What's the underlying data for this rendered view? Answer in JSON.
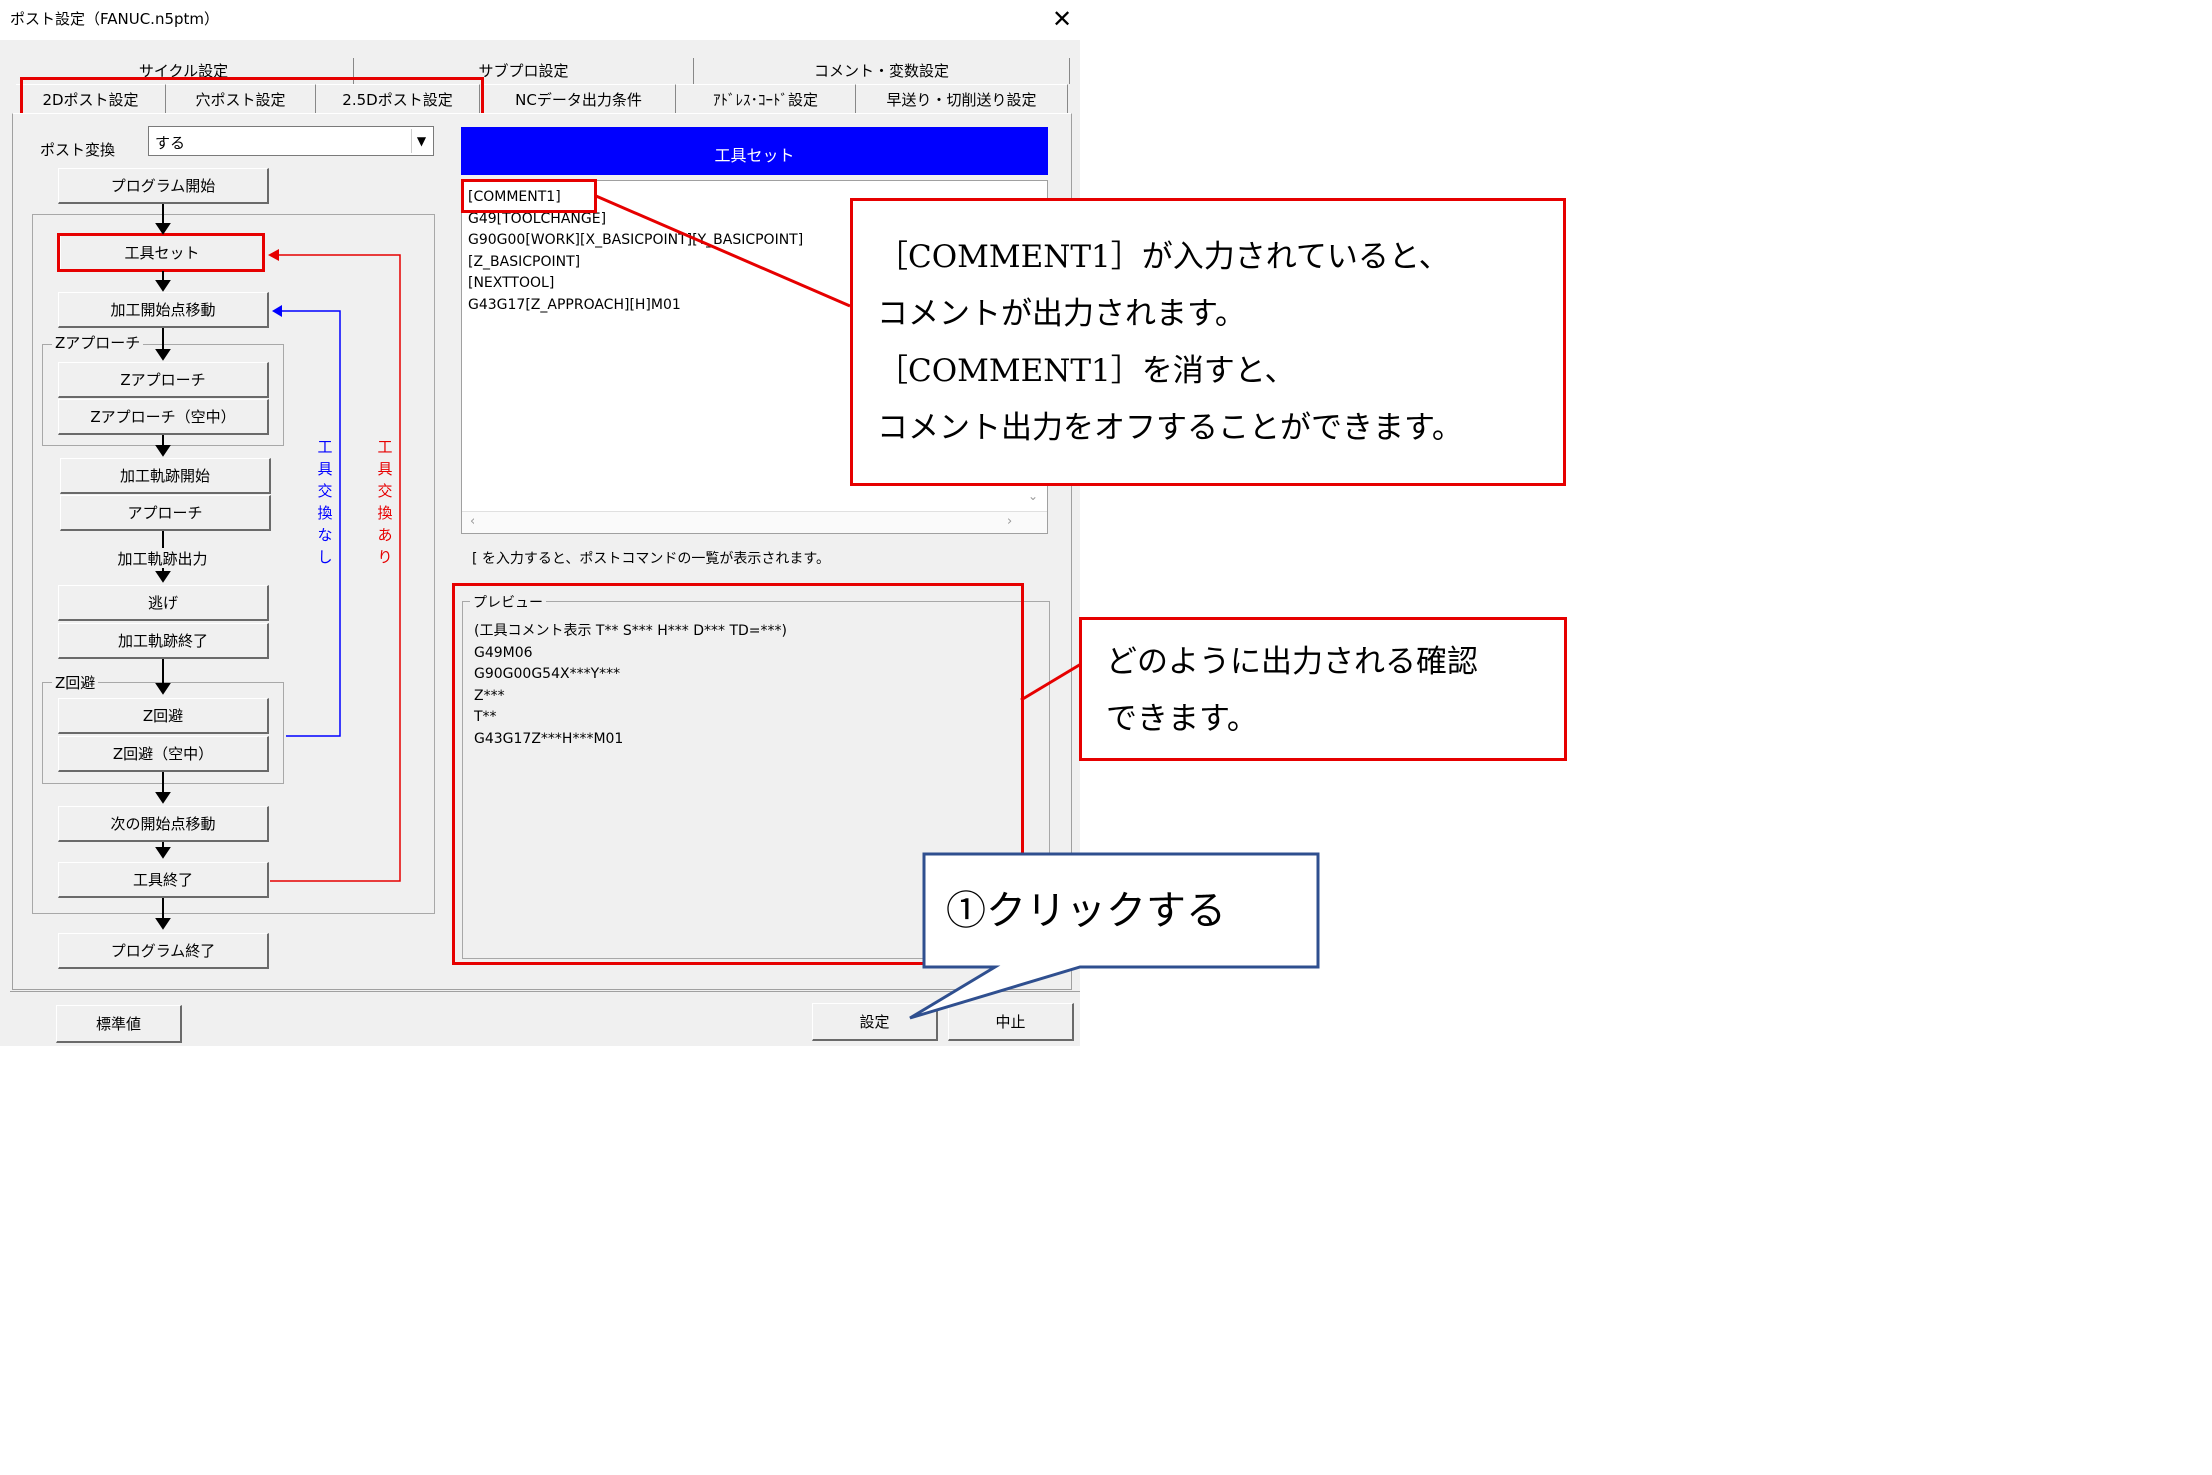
{
  "window": {
    "title": "ポスト設定（FANUC.n5ptm）",
    "close_label": "✕"
  },
  "tabs": {
    "back": [
      "サイクル設定",
      "サブプロ設定",
      "コメント・変数設定"
    ],
    "front": [
      "2Dポスト設定",
      "穴ポスト設定",
      "2.5Dポスト設定",
      "NCデータ出力条件",
      "ｱﾄﾞﾚｽ･ｺｰﾄﾞ設定",
      "早送り・切削送り設定"
    ]
  },
  "post_convert": {
    "label": "ポスト変換",
    "value": "する"
  },
  "flow": {
    "program_start": "プログラム開始",
    "tool_set": "工具セット",
    "machining_start_move": "加工開始点移動",
    "z_approach_group": "Zアプローチ",
    "z_approach": "Zアプローチ",
    "z_approach_air": "Zアプローチ（空中）",
    "path_start": "加工軌跡開始",
    "approach": "アプローチ",
    "path_output": "加工軌跡出力",
    "escape": "逃げ",
    "path_end": "加工軌跡終了",
    "z_avoid_group": "Z回避",
    "z_avoid": "Z回避",
    "z_avoid_air": "Z回避（空中）",
    "next_start_move": "次の開始点移動",
    "tool_end": "工具終了",
    "program_end": "プログラム終了",
    "no_tool_change": "工具交換なし",
    "with_tool_change": "工具交換あり"
  },
  "editor": {
    "header": "工具セット",
    "lines": [
      "[COMMENT1]",
      "G49[TOOLCHANGE]",
      "G90G00[WORK][X_BASICPOINT][Y_BASICPOINT]",
      "[Z_BASICPOINT]",
      "[NEXTTOOL]",
      "G43G17[Z_APPROACH][H]M01"
    ],
    "hint": "[ を入力すると、ポストコマンドの一覧が表示されます。"
  },
  "preview": {
    "label": "プレビュー",
    "lines": [
      "(工具コメント表示 T** S*** H*** D*** TD=***)",
      "G49M06",
      "G90G00G54X***Y***",
      "Z***",
      "T**",
      "G43G17Z***H***M01"
    ]
  },
  "buttons": {
    "default": "標準値",
    "set": "設定",
    "cancel": "中止"
  },
  "annotations": {
    "comment_note": [
      "［COMMENT1］が入力されていると、",
      "コメントが出力されます。",
      "［COMMENT1］を消すと、",
      "コメント出力をオフすることができます。"
    ],
    "preview_note": [
      "どのように出力される確認",
      "できます。"
    ],
    "click_note": "①クリックする"
  },
  "colors": {
    "header_bg": "#0000ff",
    "highlight": "#e60000",
    "loop_no_change": "#0000ff",
    "loop_change": "#e60000",
    "callout_border": "#2f4f8f"
  }
}
